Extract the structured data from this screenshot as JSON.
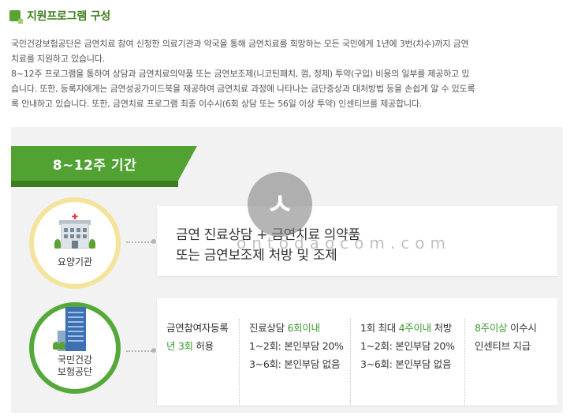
{
  "heading": {
    "title": "지원프로그램 구성"
  },
  "paragraph": {
    "lines": [
      "국민건강보험공단은 금연치료 참여 신청한 의료기관과 약국을 통해 금연치료를 희망하는 모든 국민에게 1년에 3번(차수)까지 금연",
      "치료를 지원하고 있습니다.",
      "8~12주 프로그램을 통하여 상담과 금연치료의약품 또는 금연보조제(니코틴패치, 껌, 정제) 투약(구입) 비용의 일부를 제공하고 있",
      "습니다. 또한, 등록자에게는 금연성공가이드북을 제공하여 금연치료 과정에 나타나는 금단증상과 대처방법 등을 손쉽게 알 수 있도록",
      "록 안내하고 있습니다. 또한, 금연치료 프로그램 최종 이수시(6회 상담 또는 56일 이상 투약) 인센티브를 제공합니다."
    ]
  },
  "period": {
    "label": "8~12주 기간"
  },
  "provider": {
    "label": "요양기관",
    "icon": "hospital-icon",
    "service_line1": "금연 진료상담 + 금연치료 의약품",
    "service_line2": "또는 금연보조제 처방 및 조제"
  },
  "nhis": {
    "label_line1": "국민건강",
    "label_line2": "보험공단",
    "icon": "building-icon",
    "columns": [
      {
        "l1": "금연참여자등록",
        "l2a_green": "년 3회",
        "l2b": " 허용"
      },
      {
        "l1a": "진료상담 ",
        "l1b_green": "6회이내",
        "l2": "1~2회: 본인부담 20%",
        "l3": "3~6회: 본인부담 없음"
      },
      {
        "l1a": "1회 최대 ",
        "l1b_green": "4주이내",
        "l1c": " 처방",
        "l2": "1~2회: 본인부담 20%",
        "l3": "3~6회: 본인부담 없음"
      },
      {
        "l1a_green": "8주이상",
        "l1b": " 이수시",
        "l2": "인센티브 지급"
      }
    ]
  },
  "watermark": {
    "glyph": "ㅅ",
    "text": "ontodaocom.com"
  },
  "colors": {
    "accent": "#52a133",
    "accent_dark": "#3c7d23",
    "heading": "#3f7d1d",
    "yellow_ring": "#f4e39a",
    "green_text": "#3b9a2f"
  }
}
